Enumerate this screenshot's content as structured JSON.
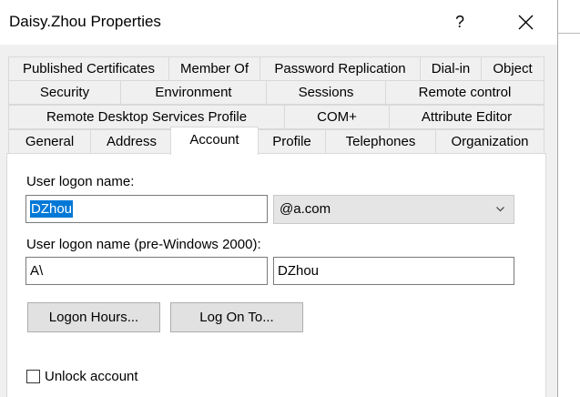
{
  "window": {
    "title": "Daisy.Zhou Properties",
    "help_glyph": "?"
  },
  "tabs": {
    "row1": [
      "Published Certificates",
      "Member Of",
      "Password Replication",
      "Dial-in",
      "Object"
    ],
    "row2": [
      "Security",
      "Environment",
      "Sessions",
      "Remote control"
    ],
    "row3": [
      "Remote Desktop Services Profile",
      "COM+",
      "Attribute Editor"
    ],
    "row4": [
      "General",
      "Address",
      "Account",
      "Profile",
      "Telephones",
      "Organization"
    ],
    "active": "Account"
  },
  "account": {
    "logon_name_label": "User logon name:",
    "logon_name_value": "DZhou",
    "domain_suffix": "@a.com",
    "pre2000_label": "User logon name (pre-Windows 2000):",
    "pre2000_domain": "A\\",
    "pre2000_user": "DZhou",
    "logon_hours_button": "Logon Hours...",
    "log_on_to_button": "Log On To...",
    "unlock_label": "Unlock account",
    "unlock_checked": false
  }
}
